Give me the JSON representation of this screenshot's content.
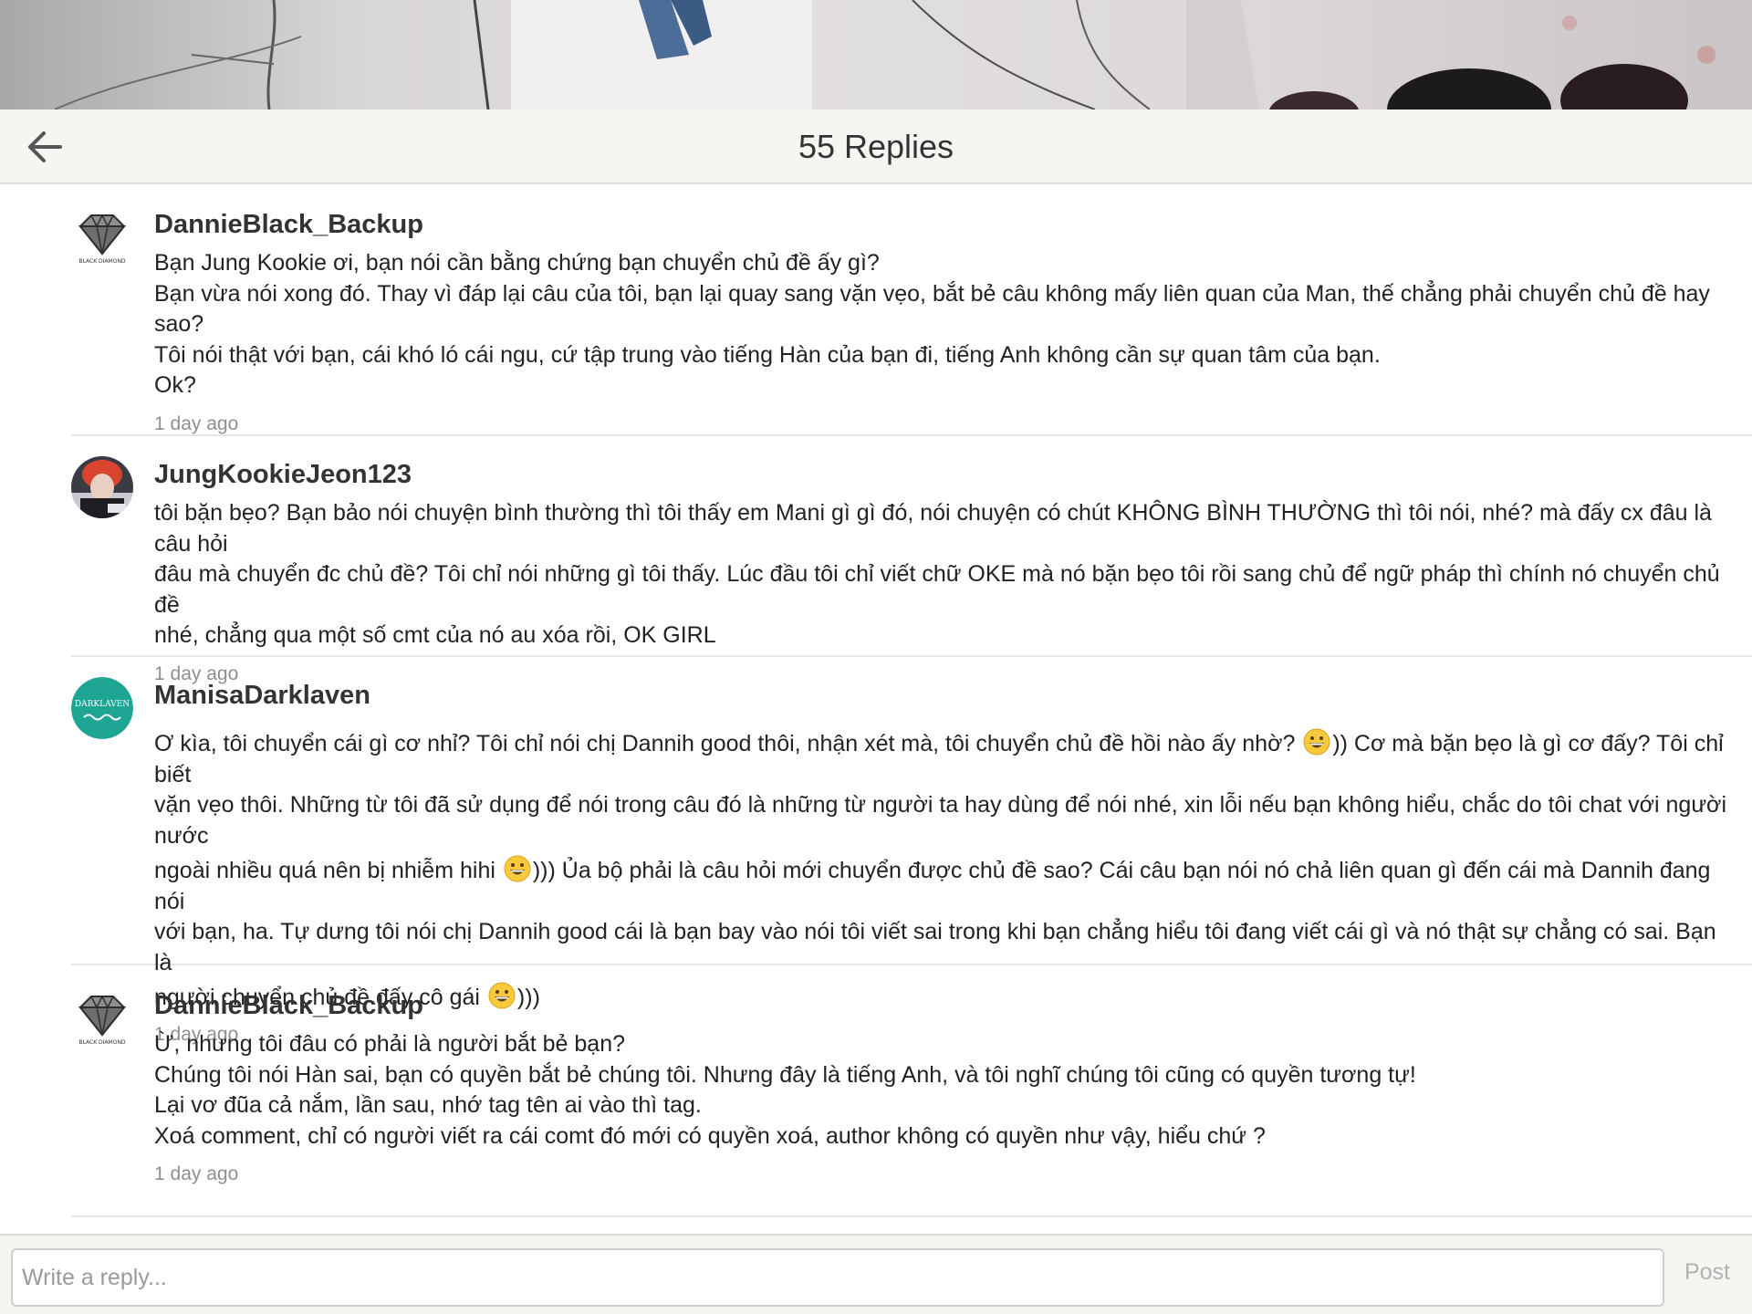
{
  "header": {
    "title": "55 Replies",
    "back_icon": "arrow-left-icon"
  },
  "colors": {
    "header_bg": "#f6f5f1",
    "divider": "#e5e5e3",
    "timestamp": "#8f8f8f",
    "post_disabled": "#b2b2b2",
    "avatar_teal": "#1ea593"
  },
  "comments": [
    {
      "username": "DannieBlack_Backup",
      "avatar": "diamond-avatar",
      "avatar_text": "BLACK DIAMOND",
      "lines": [
        "Bạn Jung Kookie ơi, bạn nói cần bằng chứng bạn chuyển chủ đề ấy gì?",
        "Bạn vừa nói xong đó. Thay vì đáp lại câu của tôi, bạn lại quay sang vặn vẹo, bắt bẻ câu không mấy liên quan của Man, thế chẳng phải chuyển chủ đề hay sao?",
        "Tôi nói thật với bạn, cái khó ló cái ngu, cứ tập trung vào tiếng Hàn của bạn đi, tiếng Anh không cần sự quan tâm của bạn.",
        "Ok?"
      ],
      "time": "1 day ago"
    },
    {
      "username": "JungKookieJeon123",
      "avatar": "photo-avatar",
      "lines": [
        "tôi bặn bẹo? Bạn bảo nói chuyện bình thường thì tôi thấy em Mani gì gì đó, nói chuyện có chút KHÔNG BÌNH THƯỜNG thì tôi nói, nhé? mà đấy cx đâu là câu hỏi",
        "đâu mà chuyển đc chủ đề? Tôi chỉ nói những gì tôi thấy. Lúc đầu tôi chỉ viết chữ OKE mà nó bặn bẹo tôi rồi sang chủ để ngữ pháp thì chính nó chuyển chủ đề",
        "nhé, chẳng qua một số cmt của nó au xóa rồi, OK GIRL"
      ],
      "time": "1 day ago"
    },
    {
      "username": "ManisaDarklaven",
      "avatar": "darklaven-avatar",
      "avatar_text": "DARKLAVEN",
      "lines_with_emoji": [
        [
          "Ơ kìa, tôi chuyển cái gì cơ nhỉ? Tôi chỉ nói chị Dannih good thôi, nhận xét mà, tôi chuyển chủ đề hồi nào ấy nhờ? ",
          "))  Cơ mà bặn bẹo là gì cơ đấy? Tôi chỉ biết"
        ],
        [
          "vặn vẹo thôi. Những từ tôi đã sử dụng để nói trong câu đó là những từ người ta hay dùng để nói nhé, xin lỗi nếu bạn không hiểu, chắc do tôi chat với người nước",
          ""
        ],
        [
          "ngoài nhiều quá nên bị nhiễm hihi ",
          "))) Ủa bộ phải là câu hỏi mới chuyển được chủ đề sao? Cái câu bạn nói nó chả liên quan gì đến cái mà Dannih đang nói"
        ],
        [
          "với bạn, ha. Tự dưng tôi nói chị Dannih good cái là bạn bay vào nói tôi viết sai trong khi bạn chẳng hiểu tôi đang viết cái gì và nó thật sự chẳng có sai. Bạn là",
          ""
        ],
        [
          "người chuyển chủ đề đấy cô gái ",
          ")))"
        ]
      ],
      "time": "1 day ago"
    },
    {
      "username": "DannieBlack_Backup",
      "avatar": "diamond-avatar",
      "avatar_text": "BLACK DIAMOND",
      "lines": [
        "Ừ, nhưng tôi đâu có phải là người bắt bẻ bạn?",
        "Chúng tôi nói Hàn sai, bạn có quyền bắt bẻ chúng tôi. Nhưng đây là tiếng Anh, và tôi nghĩ chúng tôi cũng có quyền tương tự!",
        "Lại vơ đũa cả nắm, lần sau, nhớ tag tên ai vào thì tag.",
        "Xoá comment, chỉ có người viết ra cái comt đó mới có quyền xoá, author không có quyền như vậy, hiểu chứ ?"
      ],
      "time": "1 day ago"
    }
  ],
  "composer": {
    "placeholder": "Write a reply...",
    "post_label": "Post"
  }
}
